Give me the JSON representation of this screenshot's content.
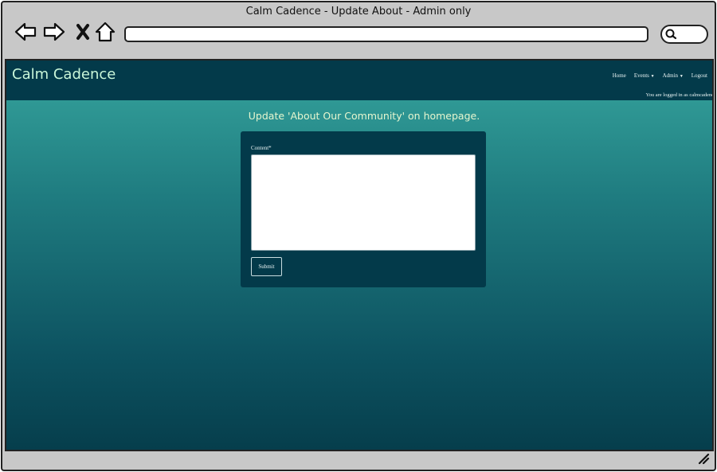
{
  "window": {
    "title": "Calm Cadence - Update About - Admin only"
  },
  "browser": {
    "icons": [
      "back-arrow-icon",
      "forward-arrow-icon",
      "close-icon",
      "home-icon",
      "search-icon",
      "resize-grip-icon"
    ],
    "url_value": ""
  },
  "navbar": {
    "brand": "Calm Cadence",
    "links": [
      {
        "label": "Home",
        "has_dropdown": false
      },
      {
        "label": "Events",
        "has_dropdown": true
      },
      {
        "label": "Admin",
        "has_dropdown": true
      },
      {
        "label": "Logout",
        "has_dropdown": false
      }
    ],
    "logged_in_text": "You are logged in as calmcadenc"
  },
  "main": {
    "heading": "Update 'About Our Community' on homepage.",
    "form": {
      "content_label": "Content*",
      "content_value": "",
      "submit_label": "Submit"
    }
  },
  "colors": {
    "navbar_bg": "#033a4a",
    "brand_text": "#c9f6d9",
    "heading_text": "#e6f6cf",
    "gradient_top": "#36a49d",
    "gradient_bottom": "#063e4c"
  }
}
